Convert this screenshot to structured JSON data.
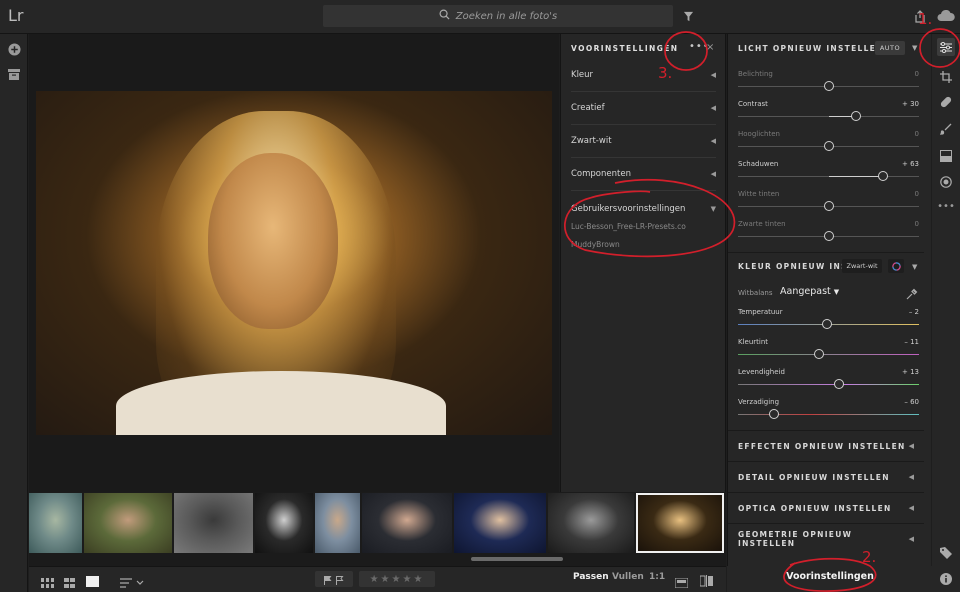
{
  "app": {
    "logo": "Lr"
  },
  "search": {
    "placeholder": "Zoeken in alle foto's"
  },
  "presets_panel": {
    "title": "VOORINSTELLINGEN",
    "more": "•••",
    "close": "×",
    "groups": [
      {
        "label": "Kleur"
      },
      {
        "label": "Creatief"
      },
      {
        "label": "Zwart-wit"
      },
      {
        "label": "Componenten"
      },
      {
        "label": "Gebruikersvoorinstellingen"
      }
    ],
    "user_presets": [
      "Luc-Besson_Free-LR-Presets.co",
      "MuddyBrown"
    ]
  },
  "light": {
    "title": "LICHT OPNIEUW INSTELLEN",
    "auto": "AUTO",
    "sliders": [
      {
        "label": "Belichting",
        "value": "0",
        "norm": 0.5,
        "dim": true
      },
      {
        "label": "Contrast",
        "value": "+ 30",
        "norm": 0.65,
        "dim": false
      },
      {
        "label": "Hooglichten",
        "value": "0",
        "norm": 0.5,
        "dim": true
      },
      {
        "label": "Schaduwen",
        "value": "+ 63",
        "norm": 0.8,
        "dim": false
      },
      {
        "label": "Witte tinten",
        "value": "0",
        "norm": 0.5,
        "dim": true
      },
      {
        "label": "Zwarte tinten",
        "value": "0",
        "norm": 0.5,
        "dim": true
      }
    ]
  },
  "color": {
    "title": "KLEUR OPNIEUW INSTEL",
    "bw": "Zwart-wit",
    "wb_label": "Witbalans",
    "wb_value": "Aangepast",
    "sliders": [
      {
        "label": "Temperatuur",
        "value": "– 2",
        "norm": 0.49,
        "cls": "temp"
      },
      {
        "label": "Kleurtint",
        "value": "– 11",
        "norm": 0.45,
        "cls": "tint"
      },
      {
        "label": "Levendigheid",
        "value": "+ 13",
        "norm": 0.56,
        "cls": "vib"
      },
      {
        "label": "Verzadiging",
        "value": "– 60",
        "norm": 0.2,
        "cls": "sat"
      }
    ]
  },
  "collapsed_sections": [
    {
      "label": "EFFECTEN OPNIEUW INSTELLEN"
    },
    {
      "label": "DETAIL OPNIEUW INSTELLEN"
    },
    {
      "label": "OPTICA OPNIEUW INSTELLEN"
    },
    {
      "label": "GEOMETRIE OPNIEUW INSTELLEN"
    }
  ],
  "bottom": {
    "fit": "Passen",
    "fill": "Vullen",
    "ratio": "1:1",
    "presets_button": "Voorinstellingen",
    "stars": "★★★★★"
  },
  "annotations": {
    "n1": "1.",
    "n2": "2.",
    "n3": "3."
  },
  "thumbnails": [
    {
      "colors": [
        "#6f8a88",
        "#a7b7a2",
        "#3d5a5a"
      ]
    },
    {
      "colors": [
        "#5c6a3a",
        "#c19b7c",
        "#3b3e22"
      ]
    },
    {
      "colors": [
        "#5a5a5a",
        "#3a3a3a",
        "#7a7a7a"
      ]
    },
    {
      "colors": [
        "#2a2a2a",
        "#cfcfcf",
        "#101010"
      ]
    },
    {
      "colors": [
        "#7d8ea0",
        "#c8a88a",
        "#4a5a6a"
      ]
    },
    {
      "colors": [
        "#2b2d33",
        "#d0a890",
        "#1a1c22"
      ]
    },
    {
      "colors": [
        "#1e2a55",
        "#e0c0a0",
        "#0e1530"
      ]
    },
    {
      "colors": [
        "#3a3a3a",
        "#9a9a9a",
        "#1a1a1a"
      ]
    },
    {
      "colors": [
        "#3a2a14",
        "#e8c080",
        "#1a120a"
      ]
    }
  ]
}
